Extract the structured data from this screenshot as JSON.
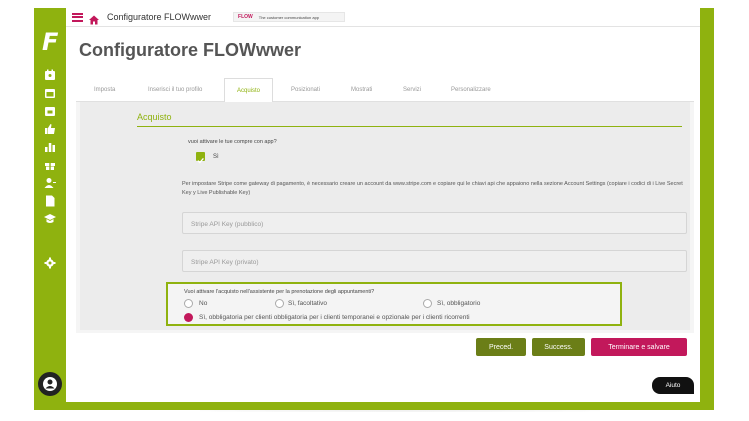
{
  "topbar": {
    "app_title": "Configuratore FLOWwwer",
    "promo_logo": "FLOW",
    "promo_text": "The customer communication app"
  },
  "sidebar": {
    "logo": "F",
    "icons": [
      "calendar-user-icon",
      "calendar-icon",
      "calendar-check-icon",
      "thumbs-up-icon",
      "bar-chart-icon",
      "gift-icon",
      "user-add-icon",
      "document-icon",
      "graduation-icon",
      "gear-icon"
    ]
  },
  "page": {
    "title": "Configuratore FLOWwwer"
  },
  "tabs": [
    {
      "label": "Imposta"
    },
    {
      "label": "Inserisci il tuo profilo"
    },
    {
      "label": "Acquisto"
    },
    {
      "label": "Posizionati"
    },
    {
      "label": "Mostrati"
    },
    {
      "label": "Servizi"
    },
    {
      "label": "Personalizzare"
    }
  ],
  "section": {
    "title": "Acquisto",
    "question1": "vuoi attivare le tue compre con app?",
    "checkbox_label": "Sì",
    "info": "Per impostare Stripe come gateway di pagamento, è necessario creare un account da www.stripe.com e copiare qui le chiavi api che appaiono nella sezione Account Settings (copiare i codici di i Live Secret Key y Live Publishable Key)",
    "stripe_public_placeholder": "Stripe API Key (pubblico)",
    "stripe_private_placeholder": "Stripe API Key (privato)",
    "question2": "Vuoi attivare l'acquisto nell'assistente per la prenotazione degli appuntamenti?",
    "options": [
      "No",
      "Sì, facoltativo",
      "Sì, obbligatorio",
      "Sì, obbligatoria per clienti obbligatoria per i clienti temporanei e opzionale per i clienti ricorrenti"
    ],
    "selected_option": 3
  },
  "buttons": {
    "prev": "Preced.",
    "next": "Success.",
    "finish": "Terminare e salvare"
  },
  "help": "Aiuto",
  "colors": {
    "accent": "#8fb20f",
    "brand": "#c2185b",
    "dark_green": "#6b7e17"
  }
}
